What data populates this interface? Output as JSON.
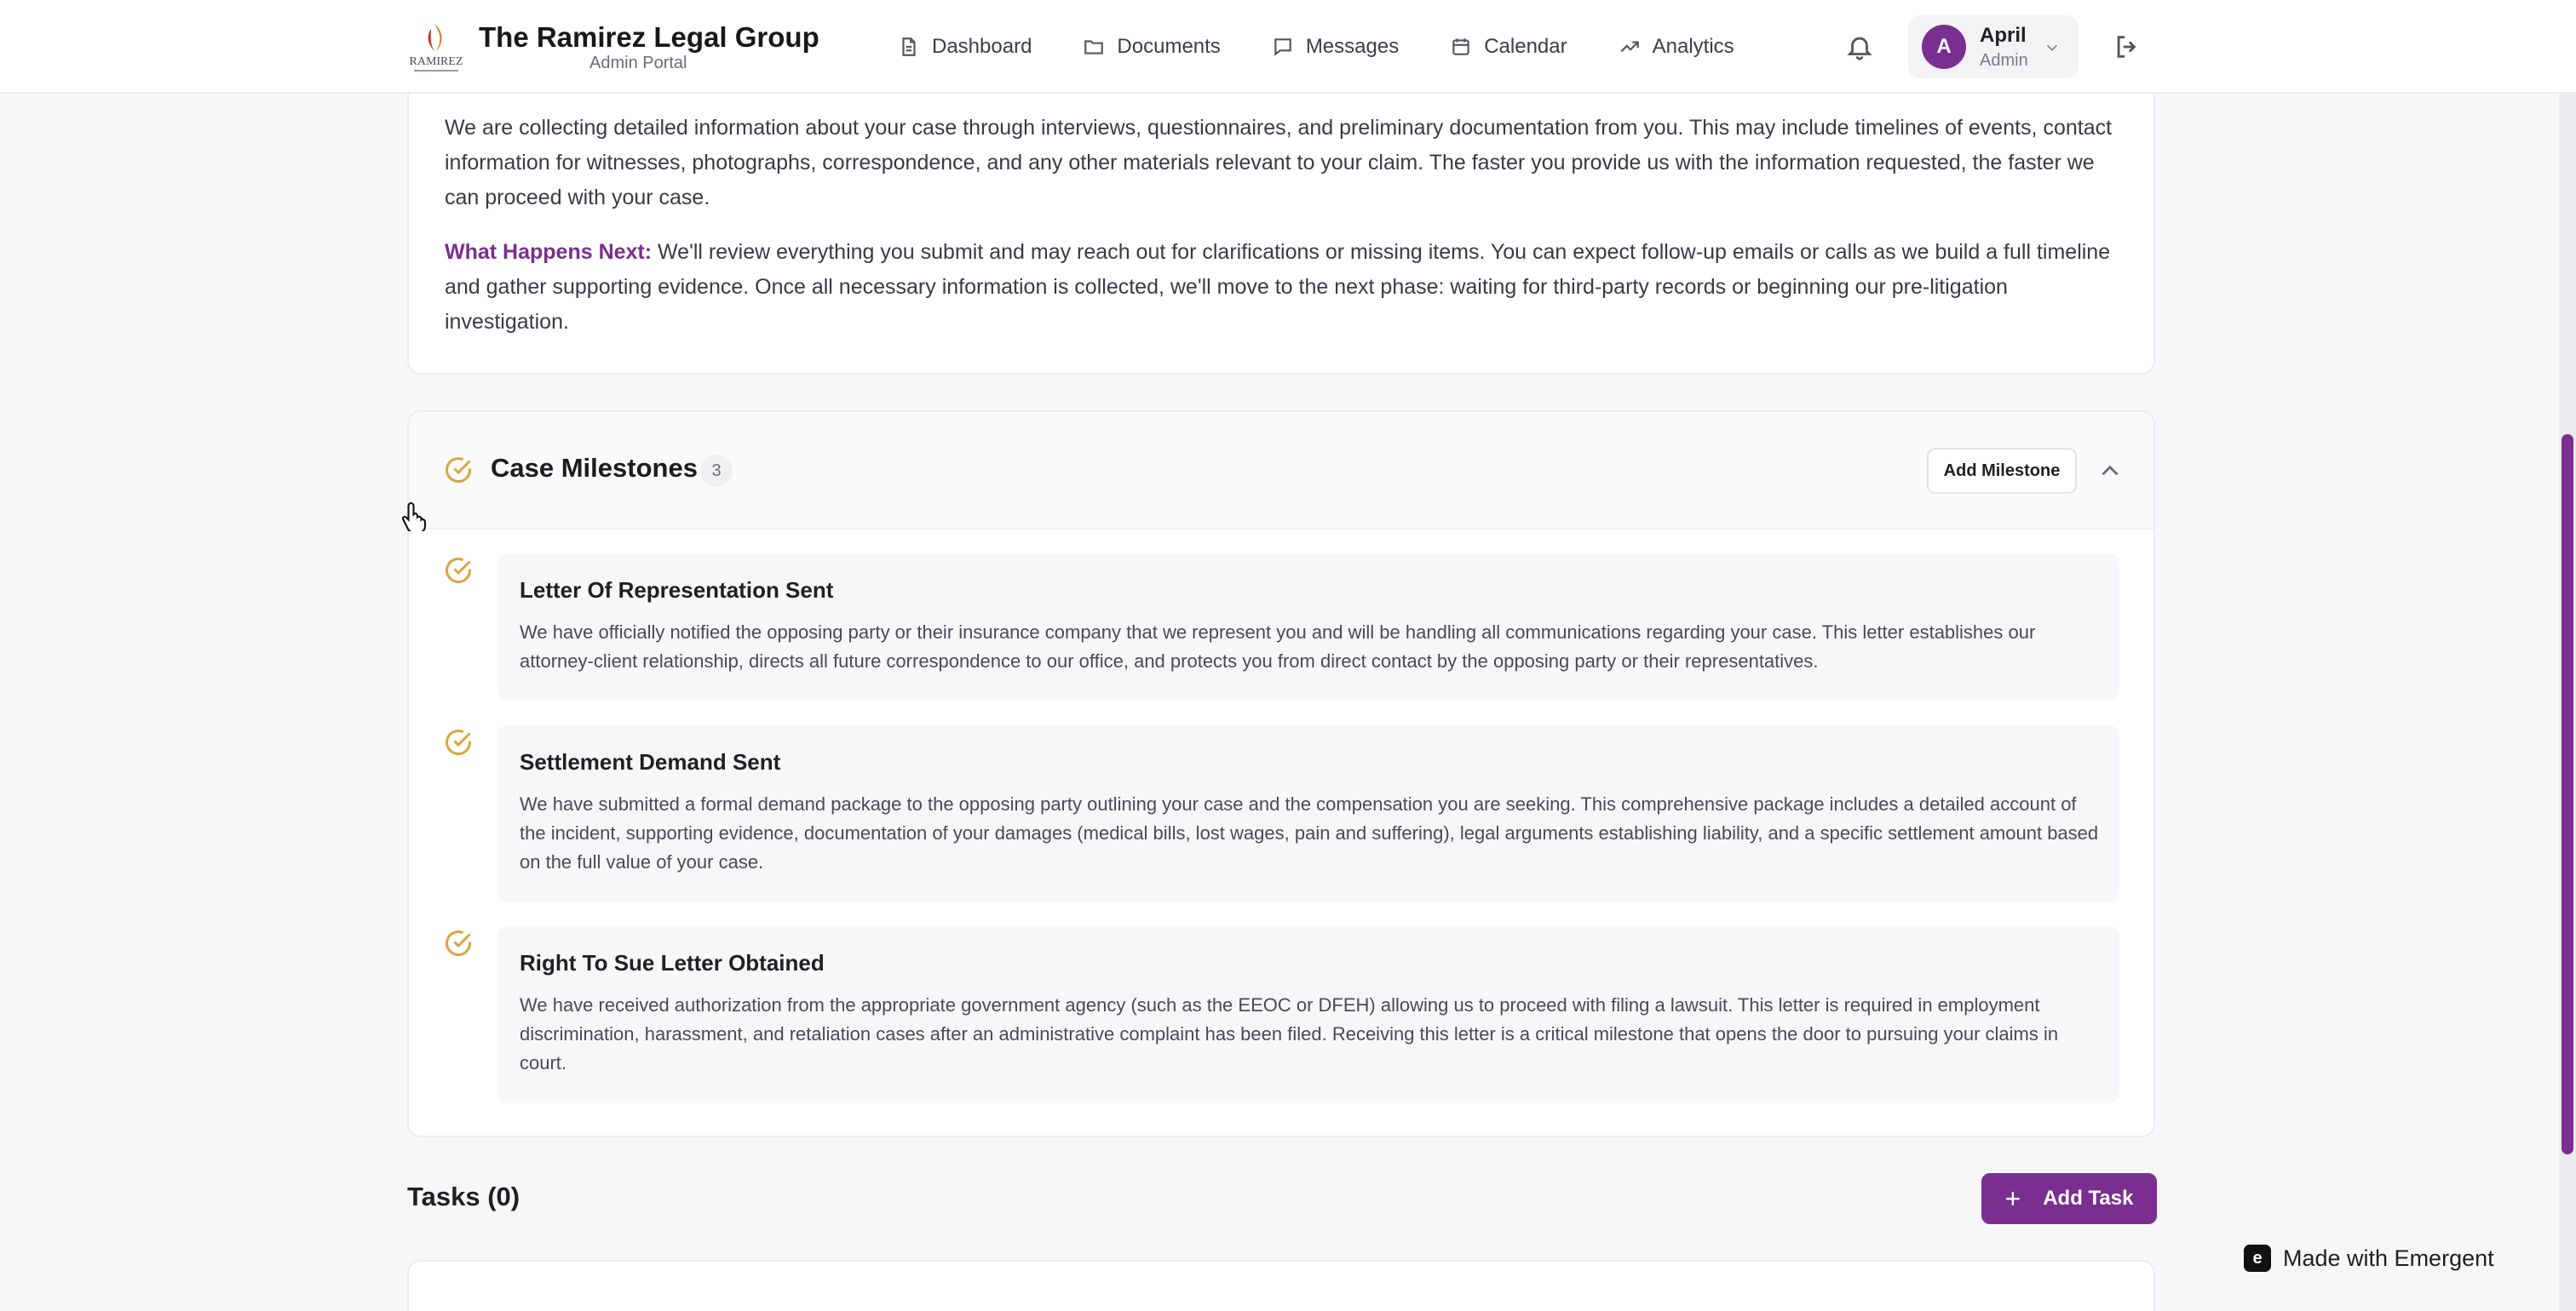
{
  "header": {
    "brand_name": "The Ramirez Legal Group",
    "brand_sub": "Admin Portal",
    "nav": [
      {
        "label": "Dashboard",
        "icon": "document-icon"
      },
      {
        "label": "Documents",
        "icon": "folder-icon"
      },
      {
        "label": "Messages",
        "icon": "message-icon"
      },
      {
        "label": "Calendar",
        "icon": "calendar-icon"
      },
      {
        "label": "Analytics",
        "icon": "trending-up-icon"
      }
    ],
    "user": {
      "initial": "A",
      "name": "April",
      "role": "Admin"
    }
  },
  "info": {
    "paragraph": "We are collecting detailed information about your case through interviews, questionnaires, and preliminary documentation from you. This may include timelines of events, contact information for witnesses, photographs, correspondence, and any other materials relevant to your claim. The faster you provide us with the information requested, the faster we can proceed with your case.",
    "next_label": "What Happens Next:",
    "next_text": " We'll review everything you submit and may reach out for clarifications or missing items. You can expect follow-up emails or calls as we build a full timeline and gather supporting evidence. Once all necessary information is collected, we'll move to the next phase: waiting for third-party records or beginning our pre-litigation investigation."
  },
  "milestones": {
    "title": "Case Milestones",
    "count": "3",
    "add_label": "Add Milestone",
    "items": [
      {
        "title": "Letter Of Representation Sent",
        "desc": "We have officially notified the opposing party or their insurance company that we represent you and will be handling all communications regarding your case. This letter establishes our attorney-client relationship, directs all future correspondence to our office, and protects you from direct contact by the opposing party or their representatives."
      },
      {
        "title": "Settlement Demand Sent",
        "desc": "We have submitted a formal demand package to the opposing party outlining your case and the compensation you are seeking. This comprehensive package includes a detailed account of the incident, supporting evidence, documentation of your damages (medical bills, lost wages, pain and suffering), legal arguments establishing liability, and a specific settlement amount based on the full value of your case."
      },
      {
        "title": "Right To Sue Letter Obtained",
        "desc": "We have received authorization from the appropriate government agency (such as the EEOC or DFEH) allowing us to proceed with filing a lawsuit. This letter is required in employment discrimination, harassment, and retaliation cases after an administrative complaint has been filed. Receiving this letter is a critical milestone that opens the door to pursuing your claims in court."
      }
    ]
  },
  "tasks": {
    "title": "Tasks (0)",
    "add_label": "Add Task"
  },
  "badge": {
    "label": "Made with Emergent",
    "icon_glyph": "e"
  },
  "colors": {
    "accent": "#7a2e90",
    "milestone_check": "#d9a441"
  }
}
